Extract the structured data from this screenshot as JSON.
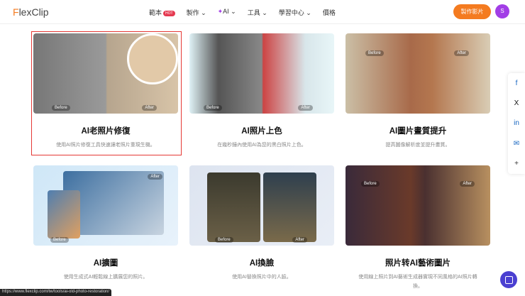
{
  "nav": {
    "logo_a": "F",
    "logo_b": "lexClip",
    "items": [
      {
        "label": "範本",
        "badge": "HOT"
      },
      {
        "label": "製作 ⌄"
      },
      {
        "label": "AI ⌄",
        "icon": "sparkle-icon"
      },
      {
        "label": "工具 ⌄"
      },
      {
        "label": "學習中心 ⌄"
      },
      {
        "label": "價格"
      }
    ],
    "cta": "製作影片",
    "avatar": "S"
  },
  "cards": [
    {
      "title": "AI老照片修復",
      "desc": "使用AI照片修復工具快速讓老照片重現生機。",
      "before": "Before",
      "after": "After"
    },
    {
      "title": "AI照片上色",
      "desc": "在幾秒鐘內使用AI為您的黑白照片上色。",
      "before": "Before",
      "after": "After"
    },
    {
      "title": "AI圖片畫質提升",
      "desc": "提高圖像解析度並提升畫質。",
      "before": "Before",
      "after": "After"
    },
    {
      "title": "AI擴圖",
      "desc": "使用生成式AI輕鬆線上擴展您的照片。",
      "before": "Before",
      "after": "After"
    },
    {
      "title": "AI換臉",
      "desc": "使用AI替換照片中的人臉。",
      "before": "Before",
      "after": "After"
    },
    {
      "title": "照片转AI藝術圖片",
      "desc": "使用線上照片到AI藝術生成器實現不同風格的AI照片轉換。",
      "before": "Before",
      "after": "After"
    }
  ],
  "share": [
    "f",
    "X",
    "in",
    "✉",
    "+"
  ],
  "status_url": "https://www.flexclip.com/tw/tools/ai-old-photo-restoration/"
}
